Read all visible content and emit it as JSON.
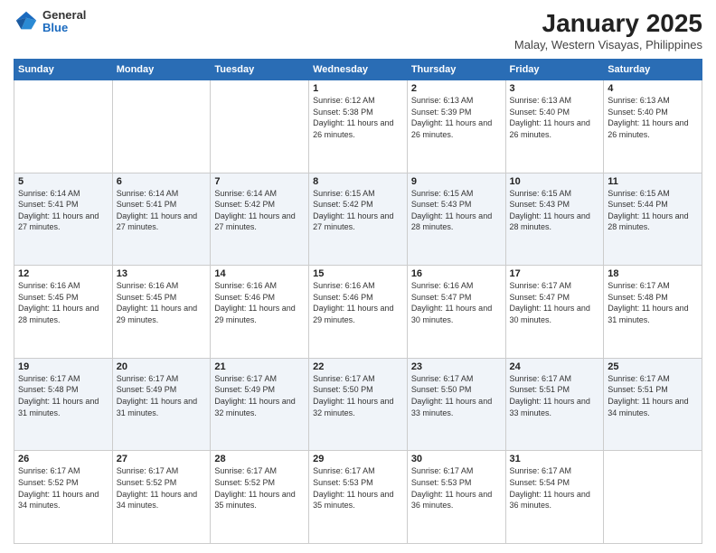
{
  "header": {
    "logo_line1": "General",
    "logo_line2": "Blue",
    "title": "January 2025",
    "subtitle": "Malay, Western Visayas, Philippines"
  },
  "days_of_week": [
    "Sunday",
    "Monday",
    "Tuesday",
    "Wednesday",
    "Thursday",
    "Friday",
    "Saturday"
  ],
  "weeks": [
    [
      {
        "day": "",
        "info": ""
      },
      {
        "day": "",
        "info": ""
      },
      {
        "day": "",
        "info": ""
      },
      {
        "day": "1",
        "info": "Sunrise: 6:12 AM\nSunset: 5:38 PM\nDaylight: 11 hours and 26 minutes."
      },
      {
        "day": "2",
        "info": "Sunrise: 6:13 AM\nSunset: 5:39 PM\nDaylight: 11 hours and 26 minutes."
      },
      {
        "day": "3",
        "info": "Sunrise: 6:13 AM\nSunset: 5:40 PM\nDaylight: 11 hours and 26 minutes."
      },
      {
        "day": "4",
        "info": "Sunrise: 6:13 AM\nSunset: 5:40 PM\nDaylight: 11 hours and 26 minutes."
      }
    ],
    [
      {
        "day": "5",
        "info": "Sunrise: 6:14 AM\nSunset: 5:41 PM\nDaylight: 11 hours and 27 minutes."
      },
      {
        "day": "6",
        "info": "Sunrise: 6:14 AM\nSunset: 5:41 PM\nDaylight: 11 hours and 27 minutes."
      },
      {
        "day": "7",
        "info": "Sunrise: 6:14 AM\nSunset: 5:42 PM\nDaylight: 11 hours and 27 minutes."
      },
      {
        "day": "8",
        "info": "Sunrise: 6:15 AM\nSunset: 5:42 PM\nDaylight: 11 hours and 27 minutes."
      },
      {
        "day": "9",
        "info": "Sunrise: 6:15 AM\nSunset: 5:43 PM\nDaylight: 11 hours and 28 minutes."
      },
      {
        "day": "10",
        "info": "Sunrise: 6:15 AM\nSunset: 5:43 PM\nDaylight: 11 hours and 28 minutes."
      },
      {
        "day": "11",
        "info": "Sunrise: 6:15 AM\nSunset: 5:44 PM\nDaylight: 11 hours and 28 minutes."
      }
    ],
    [
      {
        "day": "12",
        "info": "Sunrise: 6:16 AM\nSunset: 5:45 PM\nDaylight: 11 hours and 28 minutes."
      },
      {
        "day": "13",
        "info": "Sunrise: 6:16 AM\nSunset: 5:45 PM\nDaylight: 11 hours and 29 minutes."
      },
      {
        "day": "14",
        "info": "Sunrise: 6:16 AM\nSunset: 5:46 PM\nDaylight: 11 hours and 29 minutes."
      },
      {
        "day": "15",
        "info": "Sunrise: 6:16 AM\nSunset: 5:46 PM\nDaylight: 11 hours and 29 minutes."
      },
      {
        "day": "16",
        "info": "Sunrise: 6:16 AM\nSunset: 5:47 PM\nDaylight: 11 hours and 30 minutes."
      },
      {
        "day": "17",
        "info": "Sunrise: 6:17 AM\nSunset: 5:47 PM\nDaylight: 11 hours and 30 minutes."
      },
      {
        "day": "18",
        "info": "Sunrise: 6:17 AM\nSunset: 5:48 PM\nDaylight: 11 hours and 31 minutes."
      }
    ],
    [
      {
        "day": "19",
        "info": "Sunrise: 6:17 AM\nSunset: 5:48 PM\nDaylight: 11 hours and 31 minutes."
      },
      {
        "day": "20",
        "info": "Sunrise: 6:17 AM\nSunset: 5:49 PM\nDaylight: 11 hours and 31 minutes."
      },
      {
        "day": "21",
        "info": "Sunrise: 6:17 AM\nSunset: 5:49 PM\nDaylight: 11 hours and 32 minutes."
      },
      {
        "day": "22",
        "info": "Sunrise: 6:17 AM\nSunset: 5:50 PM\nDaylight: 11 hours and 32 minutes."
      },
      {
        "day": "23",
        "info": "Sunrise: 6:17 AM\nSunset: 5:50 PM\nDaylight: 11 hours and 33 minutes."
      },
      {
        "day": "24",
        "info": "Sunrise: 6:17 AM\nSunset: 5:51 PM\nDaylight: 11 hours and 33 minutes."
      },
      {
        "day": "25",
        "info": "Sunrise: 6:17 AM\nSunset: 5:51 PM\nDaylight: 11 hours and 34 minutes."
      }
    ],
    [
      {
        "day": "26",
        "info": "Sunrise: 6:17 AM\nSunset: 5:52 PM\nDaylight: 11 hours and 34 minutes."
      },
      {
        "day": "27",
        "info": "Sunrise: 6:17 AM\nSunset: 5:52 PM\nDaylight: 11 hours and 34 minutes."
      },
      {
        "day": "28",
        "info": "Sunrise: 6:17 AM\nSunset: 5:52 PM\nDaylight: 11 hours and 35 minutes."
      },
      {
        "day": "29",
        "info": "Sunrise: 6:17 AM\nSunset: 5:53 PM\nDaylight: 11 hours and 35 minutes."
      },
      {
        "day": "30",
        "info": "Sunrise: 6:17 AM\nSunset: 5:53 PM\nDaylight: 11 hours and 36 minutes."
      },
      {
        "day": "31",
        "info": "Sunrise: 6:17 AM\nSunset: 5:54 PM\nDaylight: 11 hours and 36 minutes."
      },
      {
        "day": "",
        "info": ""
      }
    ]
  ]
}
